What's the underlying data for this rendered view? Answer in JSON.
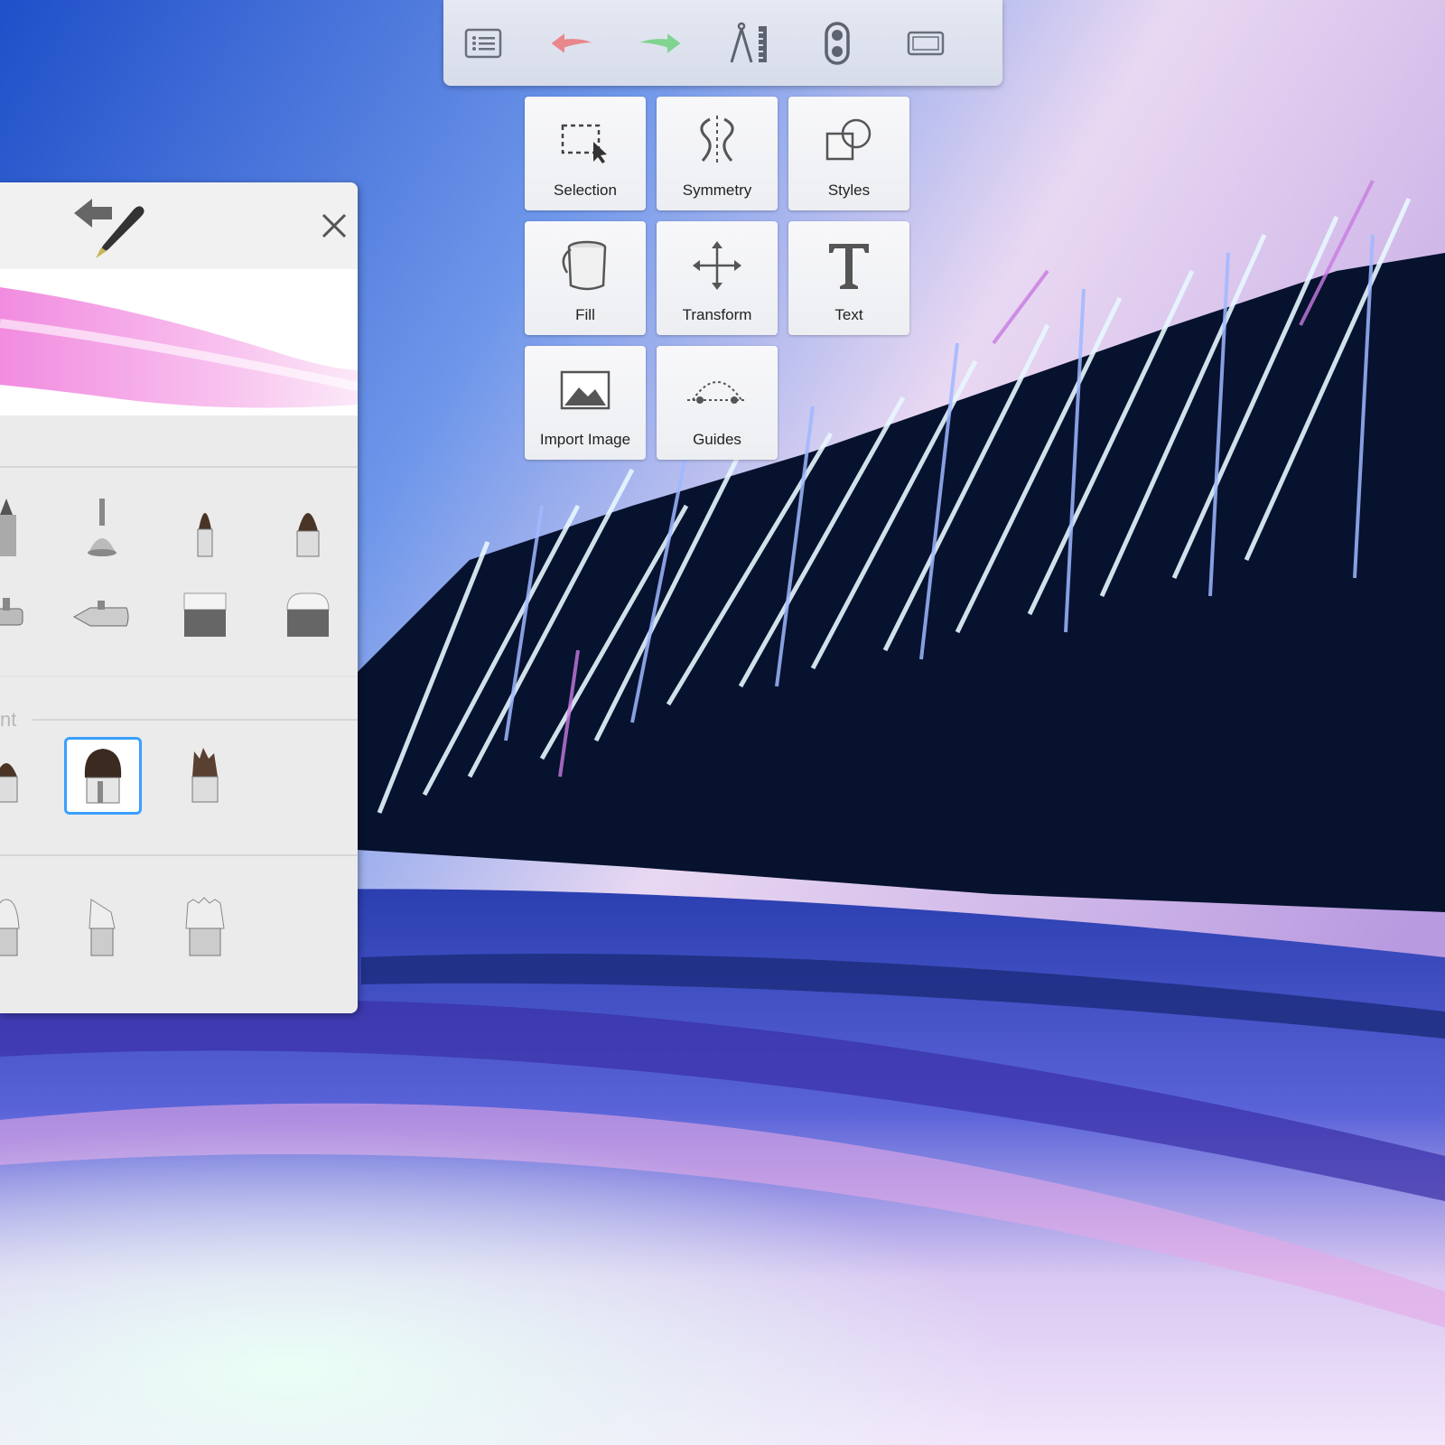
{
  "app": {
    "toolbar": {
      "items": [
        {
          "name": "layers-list",
          "icon": "list-icon"
        },
        {
          "name": "undo",
          "icon": "undo-arrow-icon"
        },
        {
          "name": "redo",
          "icon": "redo-arrow-icon"
        },
        {
          "name": "ruler-tools",
          "icon": "compass-ruler-icon"
        },
        {
          "name": "lock",
          "icon": "lock-toggle-icon"
        },
        {
          "name": "fullscreen",
          "icon": "fullscreen-frame-icon"
        }
      ]
    },
    "tools": {
      "selection": "Selection",
      "symmetry": "Symmetry",
      "styles": "Styles",
      "fill": "Fill",
      "transform": "Transform",
      "text": "Text",
      "import_image": "Import Image",
      "guides": "Guides"
    },
    "brush_panel": {
      "partial_section_label": "nt",
      "selected_brush_icon": "flat-paint-brush-icon"
    },
    "colors": {
      "accent": "#3aa0ff",
      "undo": "#e8878c",
      "redo": "#7fd48f",
      "toolbar": "#dde1ec"
    }
  }
}
